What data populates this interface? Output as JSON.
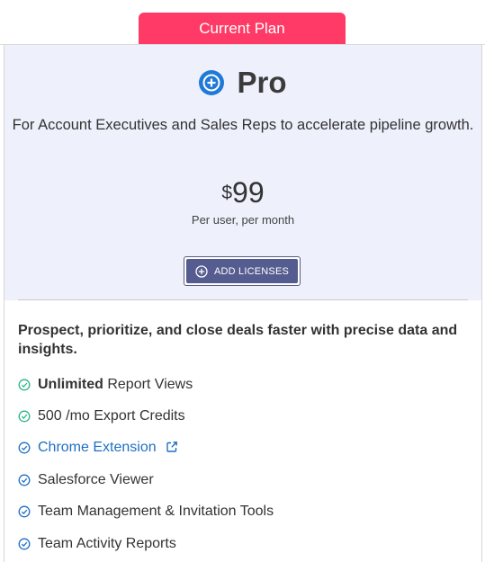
{
  "tab": {
    "label": "Current Plan"
  },
  "plan": {
    "name": "Pro",
    "description": "For Account Executives and Sales Reps to accelerate pipeline growth.",
    "price_currency": "$",
    "price_amount": "99",
    "price_period": "Per user, per month",
    "add_licenses_label": "ADD LICENSES"
  },
  "tagline": "Prospect, prioritize, and close deals faster with precise data and insights.",
  "features": [
    {
      "bold": "Unlimited",
      "label": " Report Views",
      "icon": "check-circle-icon",
      "check_color": "#2bb58a"
    },
    {
      "bold": "",
      "label": "500 /mo Export Credits",
      "icon": "check-circle-icon",
      "check_color": "#2bb58a"
    },
    {
      "bold": "",
      "label": "Chrome Extension",
      "icon": "check-circle-icon",
      "check_color": "#1f6fc4",
      "link": true,
      "link_icon": "external-link-icon"
    },
    {
      "bold": "",
      "label": "Salesforce Viewer",
      "icon": "check-circle-icon",
      "check_color": "#1f6fc4"
    },
    {
      "bold": "",
      "label": "Team Management & Invitation Tools",
      "icon": "check-circle-icon",
      "check_color": "#1f6fc4"
    },
    {
      "bold": "",
      "label": "Team Activity Reports",
      "icon": "check-circle-icon",
      "check_color": "#1f6fc4"
    }
  ],
  "colors": {
    "tab_bg": "#ff3a66",
    "header_bg": "#eef0fb",
    "button_bg": "#555c8f",
    "plan_icon": "#1f79d6",
    "link": "#1f6fc4",
    "check_green": "#2bb58a"
  }
}
